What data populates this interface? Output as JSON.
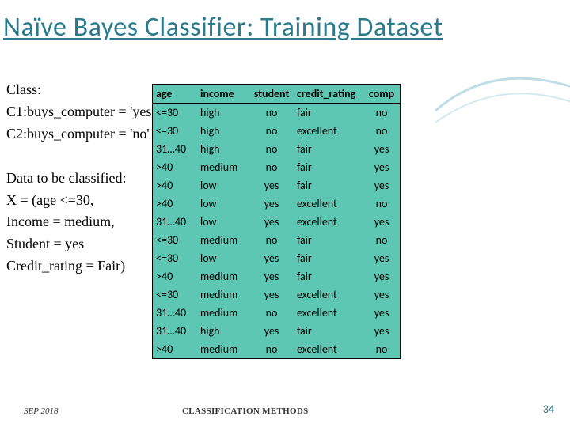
{
  "title": "Naïve Bayes Classifier: Training Dataset",
  "text": {
    "class_label": "Class:",
    "c1": "C1:buys_computer = 'yes'",
    "c2": "C2:buys_computer = 'no'",
    "data_label": "Data to be classified:",
    "x": "X = (age <=30,",
    "income": "Income = medium,",
    "student": "Student = yes",
    "credit": "Credit_rating = Fair)"
  },
  "table": {
    "headers": [
      "age",
      "income",
      "student",
      "credit_rating",
      "comp"
    ],
    "rows": [
      [
        "<=30",
        "high",
        "no",
        "fair",
        "no"
      ],
      [
        "<=30",
        "high",
        "no",
        "excellent",
        "no"
      ],
      [
        "31…40",
        "high",
        "no",
        "fair",
        "yes"
      ],
      [
        ">40",
        "medium",
        "no",
        "fair",
        "yes"
      ],
      [
        ">40",
        "low",
        "yes",
        "fair",
        "yes"
      ],
      [
        ">40",
        "low",
        "yes",
        "excellent",
        "no"
      ],
      [
        "31…40",
        "low",
        "yes",
        "excellent",
        "yes"
      ],
      [
        "<=30",
        "medium",
        "no",
        "fair",
        "no"
      ],
      [
        "<=30",
        "low",
        "yes",
        "fair",
        "yes"
      ],
      [
        ">40",
        "medium",
        "yes",
        "fair",
        "yes"
      ],
      [
        "<=30",
        "medium",
        "yes",
        "excellent",
        "yes"
      ],
      [
        "31…40",
        "medium",
        "no",
        "excellent",
        "yes"
      ],
      [
        "31…40",
        "high",
        "yes",
        "fair",
        "yes"
      ],
      [
        ">40",
        "medium",
        "no",
        "excellent",
        "no"
      ]
    ]
  },
  "footer": {
    "date": "SEP 2018",
    "mid": "CLASSIFICATION METHODS",
    "page": "34"
  },
  "chart_data": {
    "type": "table",
    "title": "Naïve Bayes Classifier: Training Dataset",
    "columns": [
      "age",
      "income",
      "student",
      "credit_rating",
      "buys_computer"
    ],
    "rows": [
      {
        "age": "<=30",
        "income": "high",
        "student": "no",
        "credit_rating": "fair",
        "buys_computer": "no"
      },
      {
        "age": "<=30",
        "income": "high",
        "student": "no",
        "credit_rating": "excellent",
        "buys_computer": "no"
      },
      {
        "age": "31…40",
        "income": "high",
        "student": "no",
        "credit_rating": "fair",
        "buys_computer": "yes"
      },
      {
        "age": ">40",
        "income": "medium",
        "student": "no",
        "credit_rating": "fair",
        "buys_computer": "yes"
      },
      {
        "age": ">40",
        "income": "low",
        "student": "yes",
        "credit_rating": "fair",
        "buys_computer": "yes"
      },
      {
        "age": ">40",
        "income": "low",
        "student": "yes",
        "credit_rating": "excellent",
        "buys_computer": "no"
      },
      {
        "age": "31…40",
        "income": "low",
        "student": "yes",
        "credit_rating": "excellent",
        "buys_computer": "yes"
      },
      {
        "age": "<=30",
        "income": "medium",
        "student": "no",
        "credit_rating": "fair",
        "buys_computer": "no"
      },
      {
        "age": "<=30",
        "income": "low",
        "student": "yes",
        "credit_rating": "fair",
        "buys_computer": "yes"
      },
      {
        "age": ">40",
        "income": "medium",
        "student": "yes",
        "credit_rating": "fair",
        "buys_computer": "yes"
      },
      {
        "age": "<=30",
        "income": "medium",
        "student": "yes",
        "credit_rating": "excellent",
        "buys_computer": "yes"
      },
      {
        "age": "31…40",
        "income": "medium",
        "student": "no",
        "credit_rating": "excellent",
        "buys_computer": "yes"
      },
      {
        "age": "31…40",
        "income": "high",
        "student": "yes",
        "credit_rating": "fair",
        "buys_computer": "yes"
      },
      {
        "age": ">40",
        "income": "medium",
        "student": "no",
        "credit_rating": "excellent",
        "buys_computer": "no"
      }
    ]
  }
}
